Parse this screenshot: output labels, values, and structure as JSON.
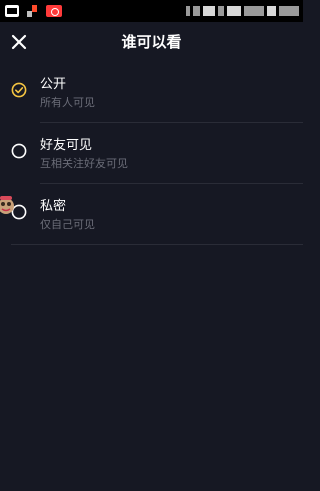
{
  "header": {
    "title": "谁可以看"
  },
  "options": [
    {
      "label": "公开",
      "desc": "所有人可见",
      "selected": true
    },
    {
      "label": "好友可见",
      "desc": "互相关注好友可见",
      "selected": false
    },
    {
      "label": "私密",
      "desc": "仅自己可见",
      "selected": false
    }
  ],
  "colors": {
    "background": "#161823",
    "accent": "#f5c542",
    "secondary_text": "#6b6d78",
    "divider": "#2a2c37"
  },
  "icons": {
    "close": "close-icon",
    "selected": "check-circle-icon",
    "unselected": "radio-empty-icon"
  }
}
